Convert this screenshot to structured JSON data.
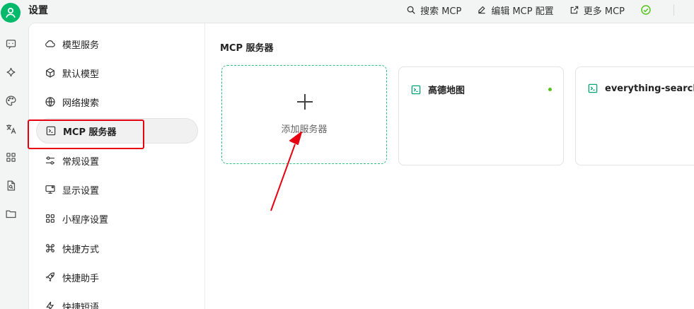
{
  "app": {
    "title": "设置"
  },
  "topbar": {
    "actions": [
      {
        "label": "搜索 MCP",
        "icon": "search-icon"
      },
      {
        "label": "编辑 MCP 配置",
        "icon": "edit-icon"
      },
      {
        "label": "更多 MCP",
        "icon": "external-link-icon"
      }
    ],
    "status_icon": "check-circle-icon"
  },
  "rail": {
    "icons": [
      "chat-icon",
      "sparkle-icon",
      "palette-icon",
      "translate-icon",
      "apps-grid-icon",
      "file-search-icon",
      "folder-icon"
    ]
  },
  "sidebar": {
    "items": [
      {
        "label": "模型服务",
        "icon": "cloud-icon",
        "active": false
      },
      {
        "label": "默认模型",
        "icon": "cube-icon",
        "active": false
      },
      {
        "label": "网络搜索",
        "icon": "globe-icon",
        "active": false
      },
      {
        "label": "MCP 服务器",
        "icon": "terminal-icon",
        "active": true
      },
      {
        "label": "常规设置",
        "icon": "sliders-icon",
        "active": false
      },
      {
        "label": "显示设置",
        "icon": "monitor-icon",
        "active": false
      },
      {
        "label": "小程序设置",
        "icon": "grid-icon",
        "active": false
      },
      {
        "label": "快捷方式",
        "icon": "command-icon",
        "active": false
      },
      {
        "label": "快捷助手",
        "icon": "rocket-icon",
        "active": false
      },
      {
        "label": "快捷短语",
        "icon": "zap-icon",
        "active": false
      }
    ]
  },
  "main": {
    "section_title": "MCP 服务器",
    "add_card": {
      "label": "添加服务器"
    },
    "servers": [
      {
        "name": "高德地图",
        "status_dot": true
      },
      {
        "name": "everything-search",
        "status_dot": false
      }
    ]
  },
  "colors": {
    "accent": "#00b96b",
    "dashed_border": "#2fbf83",
    "annotation_red": "#e60012",
    "status_green": "#52c41a"
  }
}
